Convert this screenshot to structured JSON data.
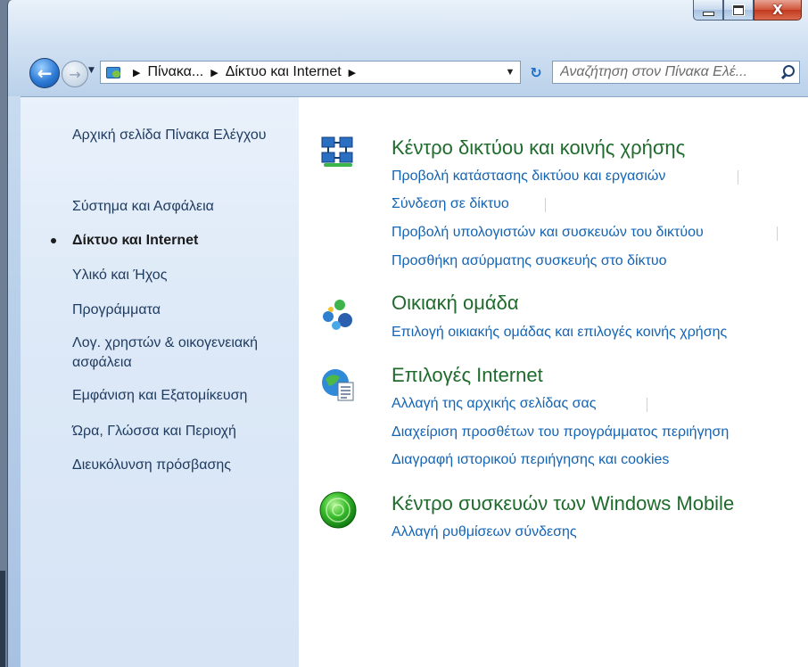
{
  "window": {
    "caption": {
      "minimize_glyph": "minimize-icon",
      "maximize_glyph": "maximize-icon",
      "close_glyph": "X"
    }
  },
  "navigation": {
    "back_icon": "back-arrow-icon",
    "forward_icon": "forward-arrow-icon",
    "breadcrumb": [
      "Πίνακα...",
      "Δίκτυο και Internet"
    ],
    "search_placeholder": "Αναζήτηση στον Πίνακα Ελέ..."
  },
  "sidebar": {
    "items": [
      {
        "label": "Αρχική σελίδα Πίνακα Ελέγχου",
        "current": false
      },
      {
        "label": "Σύστημα και Ασφάλεια",
        "current": false
      },
      {
        "label": "Δίκτυο και Internet",
        "current": true
      },
      {
        "label": "Υλικό και Ήχος",
        "current": false
      },
      {
        "label": "Προγράμματα",
        "current": false
      },
      {
        "label": "Λογ. χρηστών & οικογενειακή ασφάλεια",
        "current": false
      },
      {
        "label": "Εμφάνιση και Εξατομίκευση",
        "current": false
      },
      {
        "label": "Ώρα, Γλώσσα και Περιοχή",
        "current": false
      },
      {
        "label": "Διευκόλυνση πρόσβασης",
        "current": false
      }
    ]
  },
  "categories": [
    {
      "title": "Κέντρο δικτύου και κοινής χρήσης",
      "icon": "network-sharing-center-icon",
      "links": [
        "Προβολή κατάστασης δικτύου και εργασιών",
        "Σύνδεση σε δίκτυο",
        "Προβολή υπολογιστών και συσκευών του δικτύου",
        "Προσθήκη ασύρματης συσκευής στο δίκτυο"
      ]
    },
    {
      "title": "Οικιακή ομάδα",
      "icon": "homegroup-icon",
      "links": [
        "Επιλογή οικιακής ομάδας και επιλογές κοινής χρήσης"
      ]
    },
    {
      "title": "Επιλογές Internet",
      "icon": "internet-options-icon",
      "links": [
        "Αλλαγή της αρχικής σελίδας σας",
        "Διαχείριση προσθέτων του προγράμματος περιήγηση",
        "Διαγραφή ιστορικού περιήγησης και cookies"
      ]
    },
    {
      "title": "Κέντρο συσκευών των Windows Mobile",
      "icon": "windows-mobile-device-center-icon",
      "links": [
        "Αλλαγή ρυθμίσεων σύνδεσης"
      ]
    }
  ],
  "colors": {
    "category_title": "#1e6b2c",
    "link": "#1464b4",
    "sidebar_text": "#1e3a5f"
  }
}
